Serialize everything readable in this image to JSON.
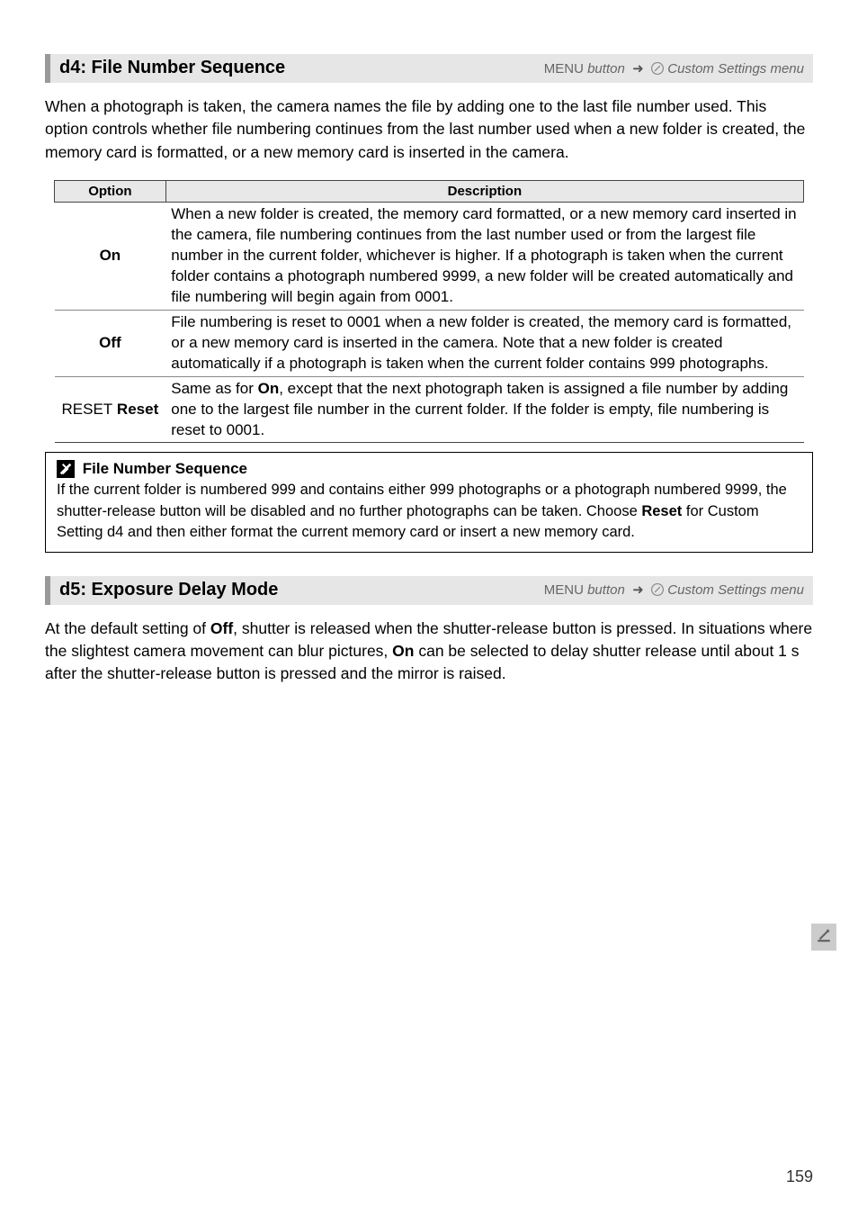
{
  "sections": {
    "d4": {
      "title": "d4: File Number Sequence",
      "menu_button_label": "MENU",
      "menu_hint": "button",
      "arrow": "➜",
      "menu_dest_prefix": "Custom Settings menu",
      "body": "When a photograph is taken, the camera names the file by adding one to the last file number used.  This option controls whether file numbering continues from the last number used when a new folder is created, the memory card is formatted, or a new memory card is inserted in the camera.",
      "table": {
        "headers": {
          "option": "Option",
          "description": "Description"
        },
        "rows": [
          {
            "option": "On",
            "description": "When a new folder is created, the memory card formatted, or a new memory card inserted in the camera, file numbering continues from the last number used or from the largest file number in the current folder, whichever is higher.  If a photograph is taken when the current folder contains a photograph numbered 9999, a new folder will be created automatically and file numbering will begin again from 0001."
          },
          {
            "option": "Off",
            "description": "File numbering is reset to 0001 when a new folder is created, the memory card is formatted, or a new memory card is inserted in the camera.  Note that a new folder is created automatically if a photograph is taken when the current folder contains 999 photographs."
          },
          {
            "option_prefix": "RESET",
            "option": "Reset",
            "description_pre": "Same as for ",
            "description_bold": "On",
            "description_post": ", except that the next photograph taken is assigned a file number by adding one to the largest file number in the current folder.  If the folder is empty, file numbering is reset to 0001."
          }
        ]
      },
      "note": {
        "title": "File Number Sequence",
        "body_pre": "If the current folder is numbered 999 and contains either 999 photographs or a photograph numbered 9999, the shutter-release button will be disabled and no further photographs can be taken.  Choose ",
        "body_bold": "Reset",
        "body_post": " for Custom Setting d4 and then either format the current memory card or insert a new memory card."
      }
    },
    "d5": {
      "title": "d5: Exposure Delay Mode",
      "menu_button_label": "MENU",
      "menu_hint": "button",
      "arrow": "➜",
      "menu_dest_prefix": "Custom Settings menu",
      "body_pre": "At the default setting of ",
      "body_bold1": "Off",
      "body_mid": ", shutter is released when the shutter-release button is pressed.  In situations where the slightest camera movement can blur pictures, ",
      "body_bold2": "On",
      "body_post": " can be selected to delay shutter release until about 1 s after the shutter-release button is pressed and the mirror is raised."
    }
  },
  "icons": {
    "pencil": "✎",
    "warn": "!"
  },
  "page_number": "159"
}
